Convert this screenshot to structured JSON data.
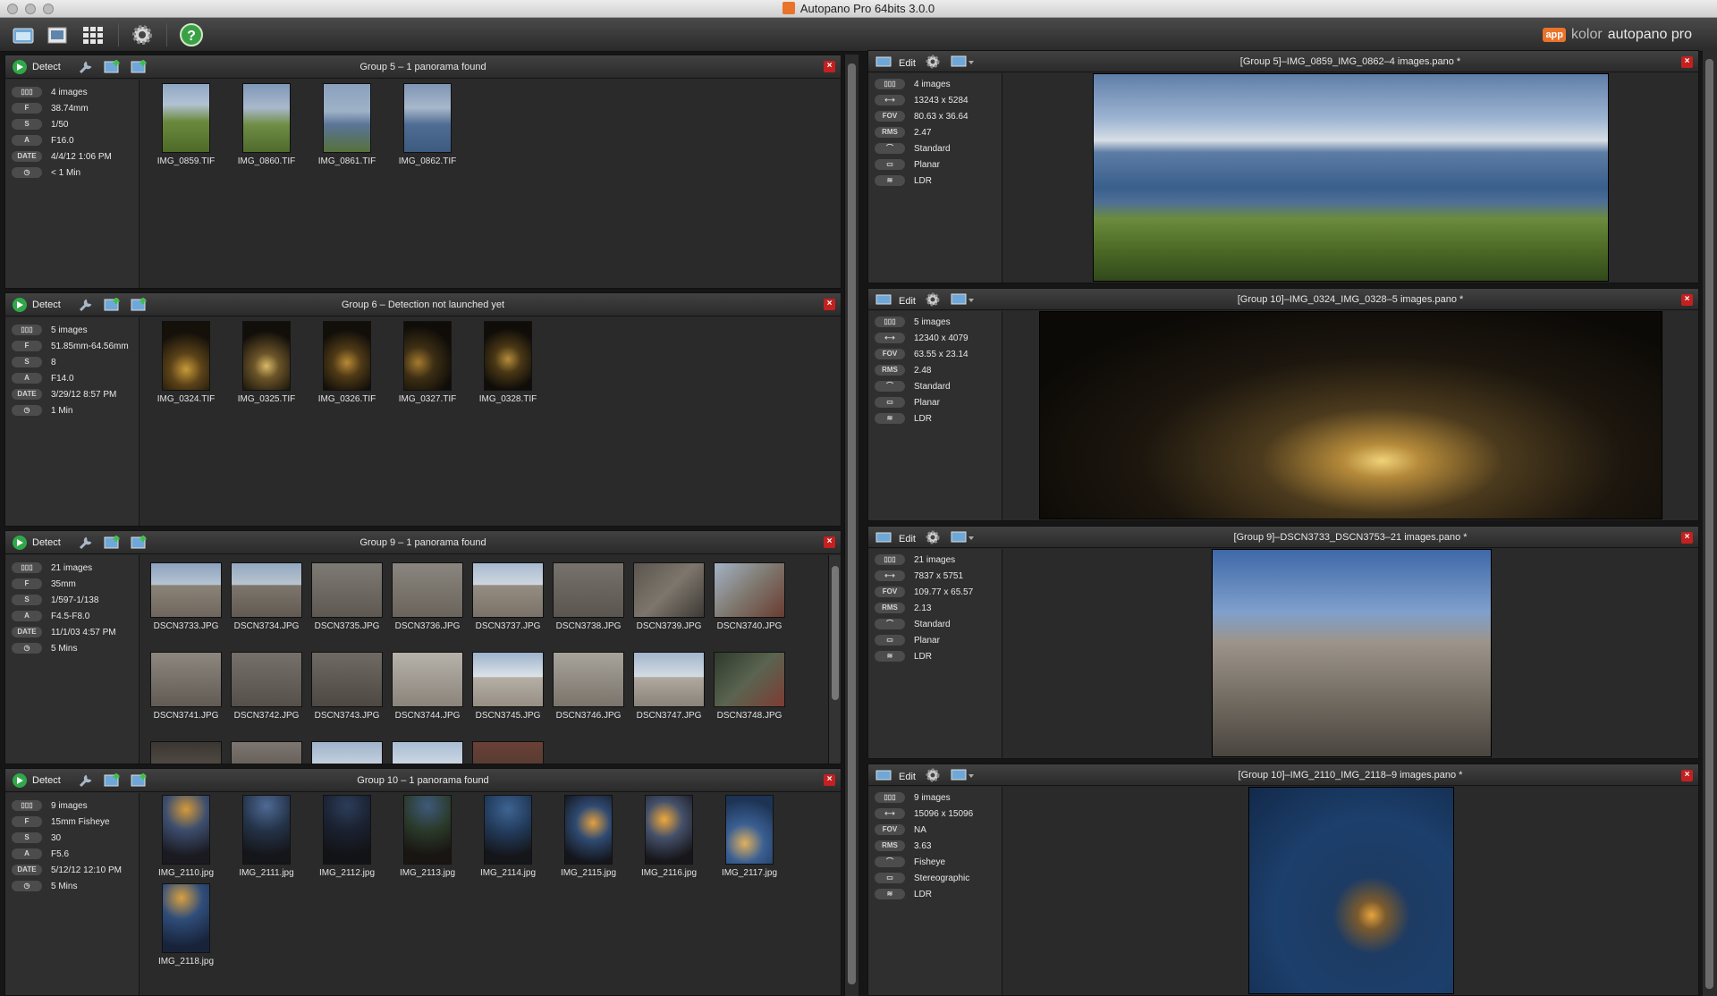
{
  "window": {
    "title": "Autopano Pro 64bits 3.0.0"
  },
  "toolbar": {
    "icons": [
      "open-images-icon",
      "import-folder-icon",
      "grid-view-icon",
      "settings-gear-icon",
      "help-icon"
    ]
  },
  "brand": {
    "badge": "app",
    "prefix": "kolor",
    "name": "autopano pro"
  },
  "groups": [
    {
      "title": "Group 5 – 1 panorama found",
      "detect": "Detect",
      "info": {
        "images": "4 images",
        "focal": "38.74mm",
        "shutter": "1/50",
        "aperture": "F16.0",
        "date": "4/4/12 1:06 PM",
        "time": "< 1 Min"
      },
      "thumbs": [
        "IMG_0859.TIF",
        "IMG_0860.TIF",
        "IMG_0861.TIF",
        "IMG_0862.TIF"
      ]
    },
    {
      "title": "Group 6 – Detection not launched yet",
      "detect": "Detect",
      "info": {
        "images": "5 images",
        "focal": "51.85mm-64.56mm",
        "shutter": "8",
        "aperture": "F14.0",
        "date": "3/29/12 8:57 PM",
        "time": "1 Min"
      },
      "thumbs": [
        "IMG_0324.TIF",
        "IMG_0325.TIF",
        "IMG_0326.TIF",
        "IMG_0327.TIF",
        "IMG_0328.TIF"
      ]
    },
    {
      "title": "Group 9 – 1 panorama found",
      "detect": "Detect",
      "info": {
        "images": "21 images",
        "focal": "35mm",
        "shutter": "1/597-1/138",
        "aperture": "F4.5-F8.0",
        "date": "11/1/03 4:57 PM",
        "time": "5 Mins"
      },
      "thumbs": [
        "DSCN3733.JPG",
        "DSCN3734.JPG",
        "DSCN3735.JPG",
        "DSCN3736.JPG",
        "DSCN3737.JPG",
        "DSCN3738.JPG",
        "DSCN3739.JPG",
        "DSCN3740.JPG",
        "DSCN3741.JPG",
        "DSCN3742.JPG",
        "DSCN3743.JPG",
        "DSCN3744.JPG",
        "DSCN3745.JPG",
        "DSCN3746.JPG",
        "DSCN3747.JPG",
        "DSCN3748.JPG"
      ]
    },
    {
      "title": "Group 10 – 1 panorama found",
      "detect": "Detect",
      "info": {
        "images": "9 images",
        "focal": "15mm Fisheye",
        "shutter": "30",
        "aperture": "F5.6",
        "date": "5/12/12 12:10 PM",
        "time": "5 Mins"
      },
      "thumbs": [
        "IMG_2110.jpg",
        "IMG_2111.jpg",
        "IMG_2112.jpg",
        "IMG_2113.jpg",
        "IMG_2114.jpg",
        "IMG_2115.jpg",
        "IMG_2116.jpg",
        "IMG_2117.jpg",
        "IMG_2118.jpg"
      ]
    }
  ],
  "info_labels": {
    "focal": "F",
    "shutter": "S",
    "aperture": "A",
    "date": "DATE",
    "size": "",
    "fov": "FOV",
    "rms": "RMS"
  },
  "panoramas": [
    {
      "title": "[Group 5]–IMG_0859_IMG_0862–4 images.pano *",
      "edit": "Edit",
      "info": {
        "images": "4 images",
        "size": "13243 x 5284",
        "fov": "80.63 x 36.64",
        "rms": "2.47",
        "quality": "Standard",
        "projection": "Planar",
        "range": "LDR"
      }
    },
    {
      "title": "[Group 10]–IMG_0324_IMG_0328–5 images.pano *",
      "edit": "Edit",
      "info": {
        "images": "5 images",
        "size": "12340 x 4079",
        "fov": "63.55 x 23.14",
        "rms": "2.48",
        "quality": "Standard",
        "projection": "Planar",
        "range": "LDR"
      }
    },
    {
      "title": "[Group 9]–DSCN3733_DSCN3753–21 images.pano *",
      "edit": "Edit",
      "info": {
        "images": "21 images",
        "size": "7837 x 5751",
        "fov": "109.77 x 65.57",
        "rms": "2.13",
        "quality": "Standard",
        "projection": "Planar",
        "range": "LDR"
      }
    },
    {
      "title": "[Group 10]–IMG_2110_IMG_2118–9 images.pano *",
      "edit": "Edit",
      "info": {
        "images": "9 images",
        "size": "15096 x 15096",
        "fov": "NA",
        "rms": "3.63",
        "quality": "Fisheye",
        "projection": "Stereographic",
        "range": "LDR"
      }
    }
  ],
  "colors": {
    "accent": "#e9732a",
    "detect_green": "#2fa84a",
    "close_red": "#c42020"
  }
}
